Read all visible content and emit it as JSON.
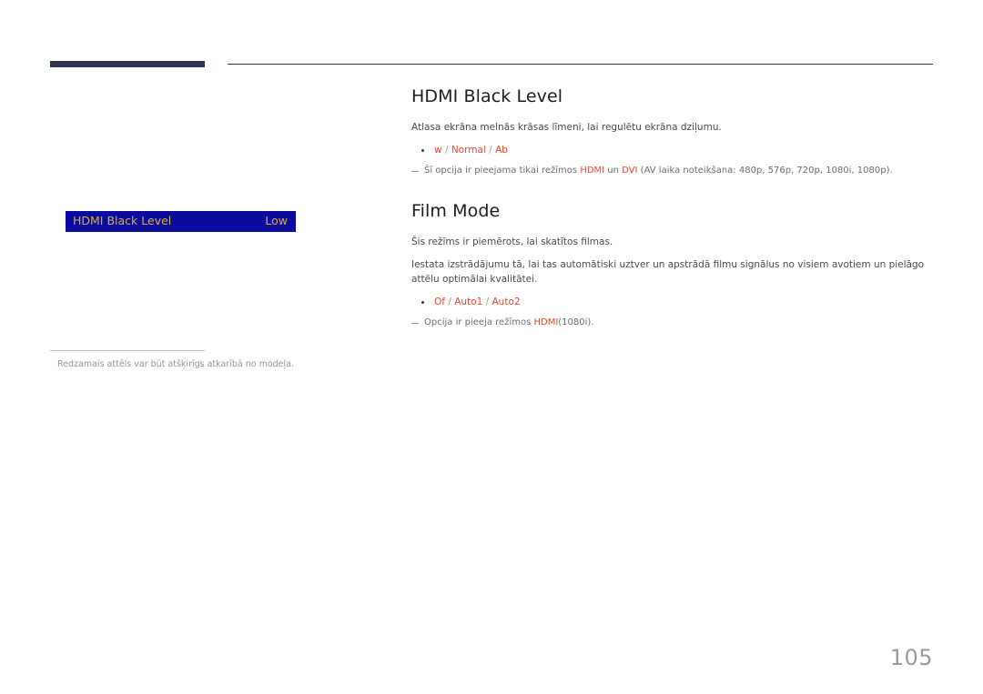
{
  "page": {
    "number": "105",
    "background_color": "#ffffff"
  },
  "header": {
    "rule_color": "#2d3550"
  },
  "osd_preview": {
    "label": "HDMI Black Level",
    "value": "Low",
    "background_color": "#0b0b9e",
    "text_color": "#d8b130"
  },
  "caption": {
    "text": "Redzamais attēls var būt atšķirīgs atkarībā no modeļa."
  },
  "sections": [
    {
      "title": "HDMI Black Level",
      "description": "Atlasa ekrāna melnās krāsas līmeni, lai regulētu ekrāna dziļumu.",
      "options": {
        "items": [
          "w",
          "Normal",
          "Ab"
        ],
        "separator": "/"
      },
      "note": {
        "prefix": "Šī opcija ir pieejama tikai režīmos ",
        "highlight1": "HDMI",
        "middle": " un ",
        "highlight2": "DVI",
        "suffix": " (AV laika noteikšana: 480p, 576p, 720p, 1080i, 1080p)."
      }
    },
    {
      "title": "Film Mode",
      "description": "Šis režīms ir piemērots, lai skatītos filmas.",
      "description2": "Iestata izstrādājumu tā, lai tas automātiski uztver un apstrādā filmu signālus no visiem avotiem un pielāgo attēlu optimālai kvalitātei.",
      "options": {
        "items": [
          "Of",
          "Auto1",
          "Auto2"
        ],
        "separator": "/"
      },
      "note": {
        "prefix": "Opcija ir pieeja režīmos ",
        "highlight1": "HDMI",
        "suffix": "(1080i)."
      }
    }
  ],
  "colors": {
    "accent_red": "#e8472b",
    "navy": "#2d3550",
    "muted_gray": "#9a9a9a"
  }
}
